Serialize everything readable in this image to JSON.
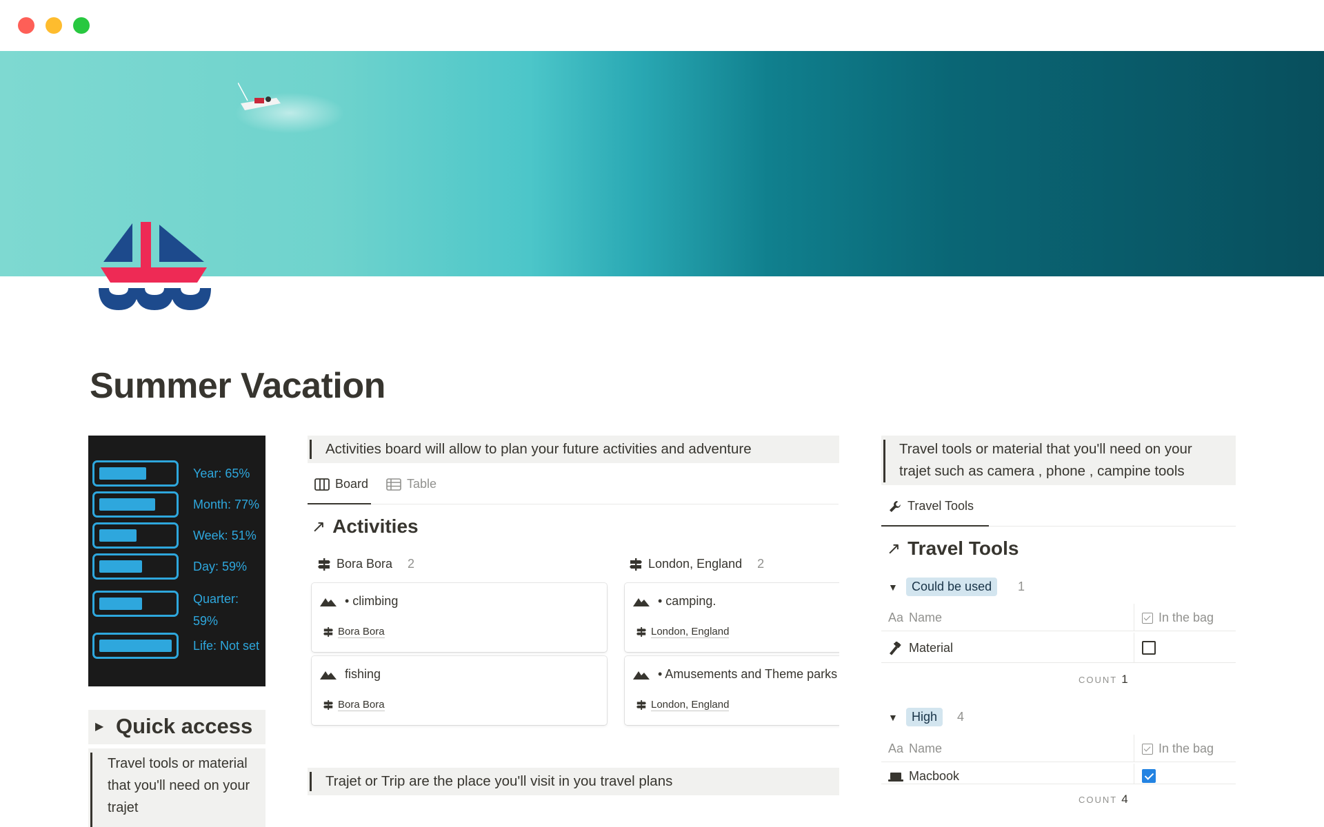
{
  "window": {
    "controls": [
      "close",
      "minimize",
      "maximize"
    ]
  },
  "page": {
    "title": "Summer Vacation",
    "icon": "sailboat-icon"
  },
  "progress": [
    {
      "label": "Year: 65%",
      "fill": 0.65
    },
    {
      "label": "Month: 77%",
      "fill": 0.77
    },
    {
      "label": "Week: 51%",
      "fill": 0.51
    },
    {
      "label": "Day: 59%",
      "fill": 0.59
    },
    {
      "label": "Quarter: 59%",
      "fill": 0.59
    },
    {
      "label": "Life: Not set",
      "fill": 1.0
    }
  ],
  "quick_access": {
    "title": "Quick access",
    "callout": "Travel tools or material that you'll need on your trajet"
  },
  "activities": {
    "callout": "Activities board will allow to plan your future activities and adventure",
    "tabs": [
      {
        "label": "Board",
        "icon": "board-icon",
        "active": true
      },
      {
        "label": "Table",
        "icon": "table-icon",
        "active": false
      }
    ],
    "title": "Activities",
    "groups": [
      {
        "name": "Bora Bora",
        "count": "2",
        "cards": [
          {
            "title": "• climbing",
            "place": "Bora Bora"
          },
          {
            "title": "fishing",
            "place": "Bora Bora"
          }
        ]
      },
      {
        "name": "London, England",
        "count": "2",
        "cards": [
          {
            "title": "• camping.",
            "place": "London, England"
          },
          {
            "title": "• Amusements and Theme parks",
            "place": "London, England"
          }
        ]
      }
    ]
  },
  "trips": {
    "callout": "Trajet or Trip are the place you'll visit in you travel plans"
  },
  "travel_tools": {
    "callout": "Travel tools or material that you'll need on your trajet such as camera , phone , campine tools",
    "tab": "Travel Tools",
    "title": "Travel Tools",
    "columns": {
      "name": "Name",
      "name_prefix": "Aa",
      "bag": "In the bag"
    },
    "count_label": "COUNT",
    "groups": [
      {
        "label": "Could be used",
        "count": "1",
        "rows": [
          {
            "name": "Material",
            "in_bag": false,
            "icon": "hammer-icon"
          }
        ],
        "footer_count": "1"
      },
      {
        "label": "High",
        "count": "4",
        "rows": [
          {
            "name": "Macbook",
            "in_bag": true,
            "icon": "laptop-icon"
          }
        ],
        "footer_count": "4"
      }
    ]
  },
  "colors": {
    "accent_progress": "#2ea7dd",
    "text": "#37352f",
    "muted": "#91918e",
    "pill_blue": "#d3e5ef",
    "checkbox_on": "#2383e2"
  }
}
